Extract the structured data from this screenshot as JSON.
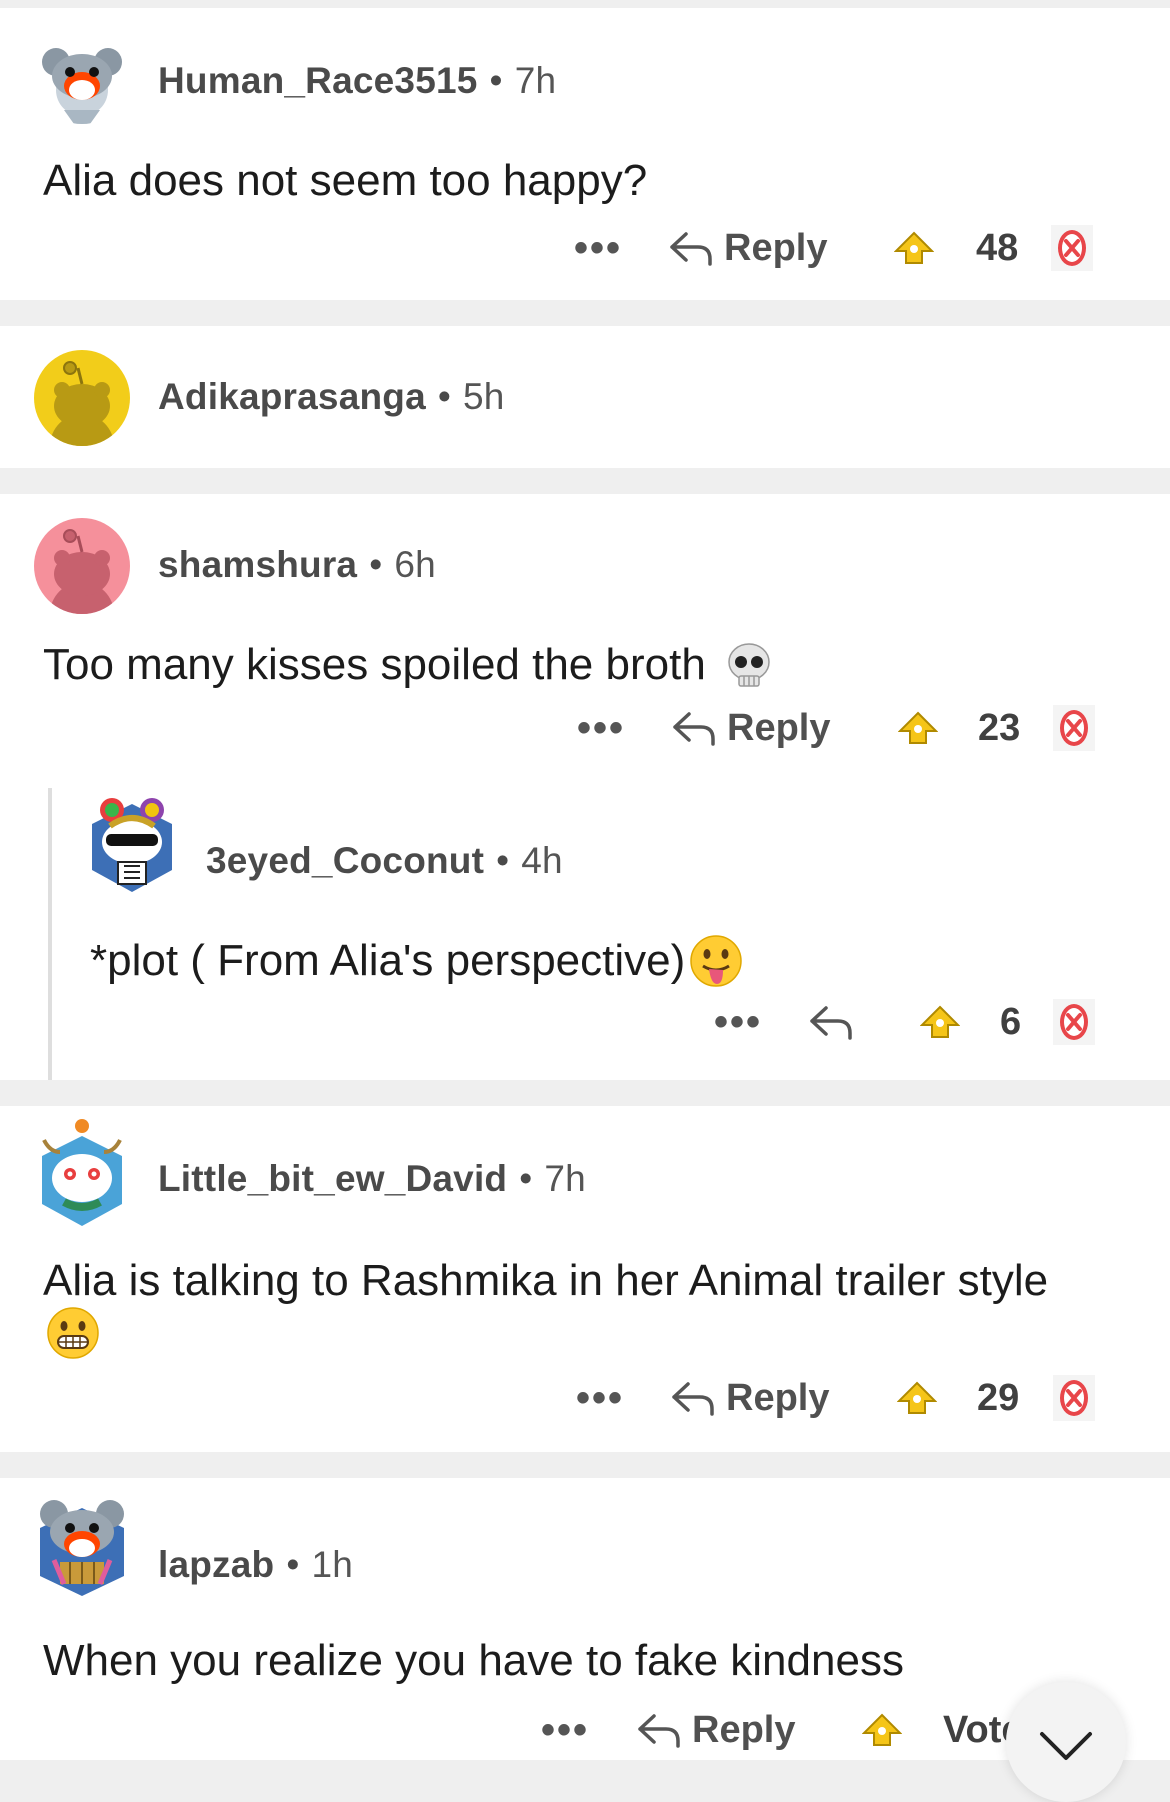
{
  "comments": [
    {
      "username": "Human_Race3515",
      "age": "7h",
      "text": "Alia does not seem too happy?",
      "reply_label": "Reply",
      "score": "48"
    },
    {
      "username": "Adikaprasanga",
      "age": "5h"
    },
    {
      "username": "shamshura",
      "age": "6h",
      "text": "Too many kisses spoiled the broth",
      "reply_label": "Reply",
      "score": "23"
    },
    {
      "username": "3eyed_Coconut",
      "age": "4h",
      "text": "*plot ( From Alia's perspective)",
      "score": "6"
    },
    {
      "username": "Little_bit_ew_David",
      "age": "7h",
      "text": "Alia is talking to Rashmika in her Animal trailer style",
      "reply_label": "Reply",
      "score": "29"
    },
    {
      "username": "lapzab",
      "age": "1h",
      "text": "When you realize you have to fake kindness",
      "reply_label": "Reply",
      "score": "Vote"
    }
  ],
  "separator": "•",
  "more_label": "•••",
  "icons": {
    "more": "more-options-icon",
    "reply": "reply-arrow-icon",
    "upvote": "upvote-award-icon",
    "downvote": "downvote-icon",
    "scroll": "chevron-down-icon"
  },
  "colors": {
    "card": "#ffffff",
    "page_bg": "#efefef",
    "downvote": "#e8464a",
    "upvote": "#f5c518"
  }
}
